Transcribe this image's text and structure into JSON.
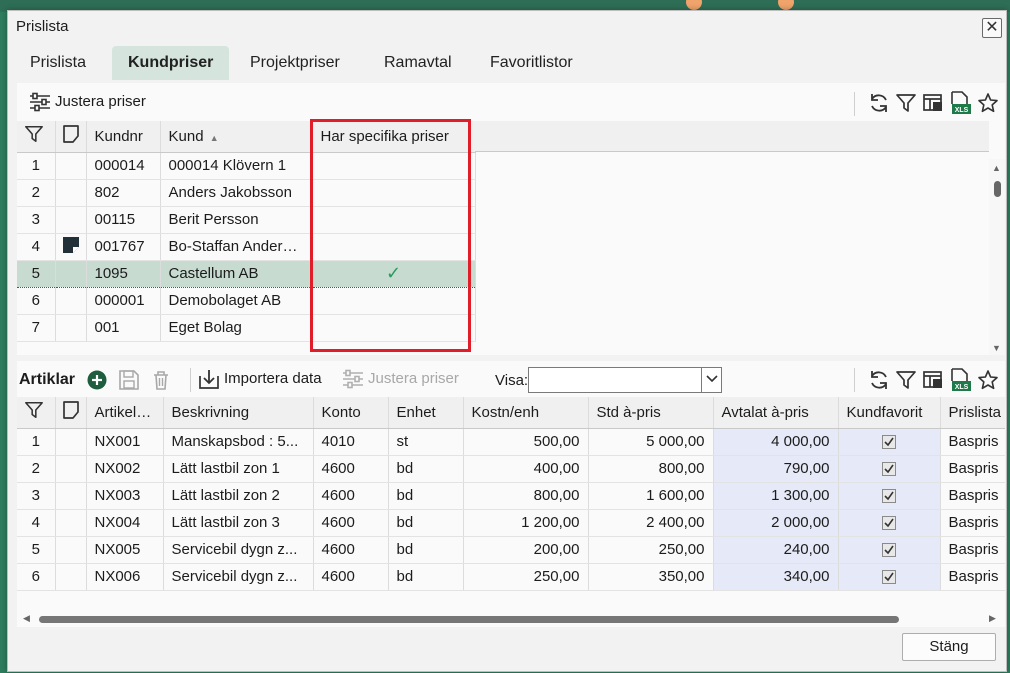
{
  "window": {
    "title": "Prislista",
    "close_glyph": "✕"
  },
  "tabs": [
    "Prislista",
    "Kundpriser",
    "Projektpriser",
    "Ramavtal",
    "Favoritlistor"
  ],
  "active_tab": "Kundpriser",
  "top_toolbar": {
    "adjust_label": "Justera priser"
  },
  "customer_table": {
    "headers": {
      "kundnr": "Kundnr",
      "kund": "Kund",
      "specific": "Har specifika priser",
      "sort_glyph": "▲"
    },
    "rows": [
      {
        "n": "1",
        "kundnr": "000014",
        "kund": "000014 Klövern 1",
        "specific": ""
      },
      {
        "n": "2",
        "kundnr": "802",
        "kund": "Anders Jakobsson",
        "specific": ""
      },
      {
        "n": "3",
        "kundnr": "00115",
        "kund": "Berit Persson",
        "specific": ""
      },
      {
        "n": "4",
        "kundnr": "001767",
        "kund": "Bo-Staffan Andersson",
        "specific": ""
      },
      {
        "n": "5",
        "kundnr": "1095",
        "kund": "Castellum AB",
        "specific": "✓"
      },
      {
        "n": "6",
        "kundnr": "000001",
        "kund": "Demobolaget AB",
        "specific": ""
      },
      {
        "n": "7",
        "kundnr": "001",
        "kund": "Eget Bolag",
        "specific": ""
      }
    ],
    "selected_row": 5
  },
  "articles_toolbar": {
    "title": "Artiklar",
    "import_label": "Importera data",
    "adjust_label": "Justera priser",
    "visa_label": "Visa:",
    "visa_value": ""
  },
  "article_table": {
    "headers": {
      "artikelnr": "Artikelnr",
      "beskrivning": "Beskrivning",
      "konto": "Konto",
      "enhet": "Enhet",
      "kostn": "Kostn/enh",
      "std": "Std à-pris",
      "avtalat": "Avtalat à-pris",
      "kundfavorit": "Kundfavorit",
      "prislista": "Prislista"
    },
    "rows": [
      {
        "n": "1",
        "artikelnr": "NX001",
        "beskrivning": "Manskapsbod : 5...",
        "konto": "4010",
        "enhet": "st",
        "kostn": "500,00",
        "std": "5 000,00",
        "avtalat": "4 000,00",
        "prislista": "Baspris"
      },
      {
        "n": "2",
        "artikelnr": "NX002",
        "beskrivning": "Lätt lastbil zon 1",
        "konto": "4600",
        "enhet": "bd",
        "kostn": "400,00",
        "std": "800,00",
        "avtalat": "790,00",
        "prislista": "Baspris"
      },
      {
        "n": "3",
        "artikelnr": "NX003",
        "beskrivning": "Lätt lastbil zon 2",
        "konto": "4600",
        "enhet": "bd",
        "kostn": "800,00",
        "std": "1 600,00",
        "avtalat": "1 300,00",
        "prislista": "Baspris"
      },
      {
        "n": "4",
        "artikelnr": "NX004",
        "beskrivning": "Lätt lastbil zon 3",
        "konto": "4600",
        "enhet": "bd",
        "kostn": "1 200,00",
        "std": "2 400,00",
        "avtalat": "2 000,00",
        "prislista": "Baspris"
      },
      {
        "n": "5",
        "artikelnr": "NX005",
        "beskrivning": "Servicebil dygn z...",
        "konto": "4600",
        "enhet": "bd",
        "kostn": "200,00",
        "std": "250,00",
        "avtalat": "240,00",
        "prislista": "Baspris"
      },
      {
        "n": "6",
        "artikelnr": "NX006",
        "beskrivning": "Servicebil dygn z...",
        "konto": "4600",
        "enhet": "bd",
        "kostn": "250,00",
        "std": "350,00",
        "avtalat": "340,00",
        "prislista": "Baspris"
      }
    ]
  },
  "close_button_label": "Stäng",
  "colors": {
    "accent": "#2e7d5f",
    "tab_active_bg": "#d5e5dd",
    "highlight_box": "#e21d2a",
    "agreed_column_bg": "#e6e9f8",
    "check_green": "#2a9a5c"
  }
}
